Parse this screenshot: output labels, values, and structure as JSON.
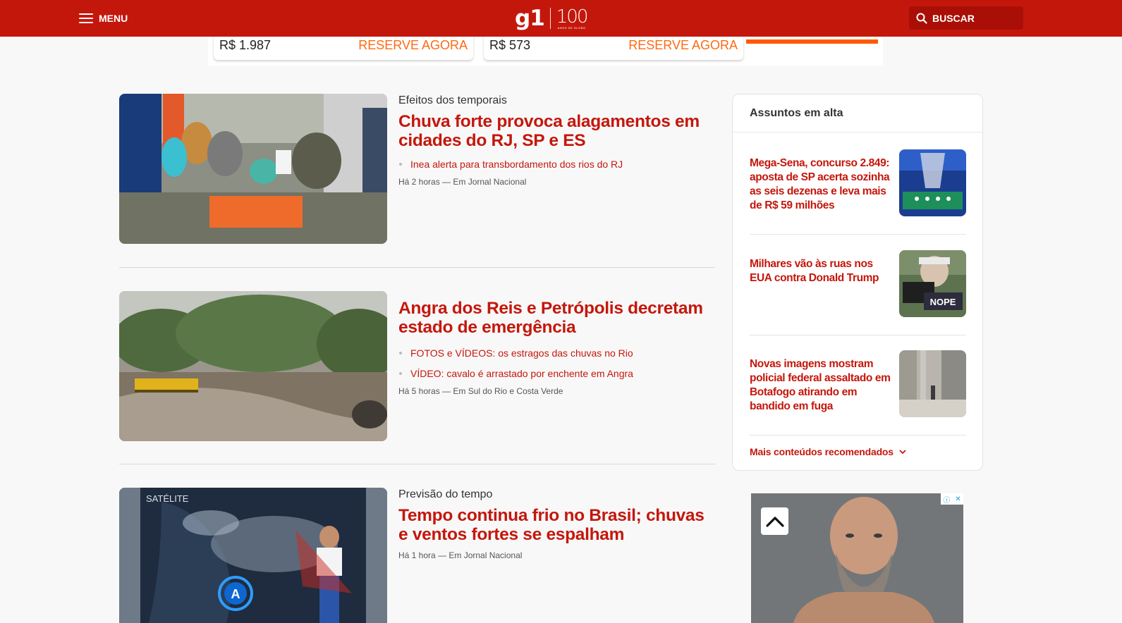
{
  "header": {
    "menu_label": "MENU",
    "logo_text": "g1",
    "logo_anniversary": "100",
    "logo_anniversary_sub": "ANOS DE GLOBO",
    "search_label": "BUSCAR",
    "brand_color": "#c4170c"
  },
  "top_ad": {
    "cards": [
      {
        "price": "R$ 1.987",
        "cta": "RESERVE AGORA"
      },
      {
        "price": "R$ 573",
        "cta": "RESERVE AGORA"
      }
    ],
    "accent_color": "#ff6a13"
  },
  "feed": [
    {
      "chapeu": "Efeitos dos temporais",
      "headline": "Chuva forte provoca alagamentos em cidades do RJ, SP e ES",
      "related": [
        "Inea alerta para transbordamento dos rios do RJ"
      ],
      "meta": "Há 2 horas — Em Jornal Nacional"
    },
    {
      "chapeu": "",
      "headline": "Angra dos Reis e Petrópolis decretam estado de emergência",
      "related": [
        "FOTOS e VÍDEOS: os estragos das chuvas no Rio",
        "VÍDEO: cavalo é arrastado por enchente em Angra"
      ],
      "meta": "Há 5 horas — Em Sul do Rio e Costa Verde"
    },
    {
      "chapeu": "Previsão do tempo",
      "headline": "Tempo continua frio no Brasil; chuvas e ventos fortes se espalham",
      "related": [],
      "meta": "Há 1 hora — Em Jornal Nacional",
      "thumb_caption": "SATÉLITE"
    }
  ],
  "trending": {
    "title": "Assuntos em alta",
    "items": [
      {
        "text": "Mega-Sena, concurso 2.849: aposta de SP acerta sozinha as seis dezenas e leva mais de R$ 59 milhões"
      },
      {
        "text": "Milhares vão às ruas nos EUA contra Donald Trump",
        "thumb_sign": "NOPE"
      },
      {
        "text": "Novas imagens mostram policial federal assaltado em Botafogo atirando em bandido em fuga"
      }
    ],
    "more_label": "Mais conteúdos recomendados"
  },
  "icons": {
    "menu": "hamburger-icon",
    "search": "search-icon",
    "chevron": "chevron-down-icon",
    "scroll_up": "chevron-up-icon",
    "ad_choices": "ad-choices-icon"
  }
}
